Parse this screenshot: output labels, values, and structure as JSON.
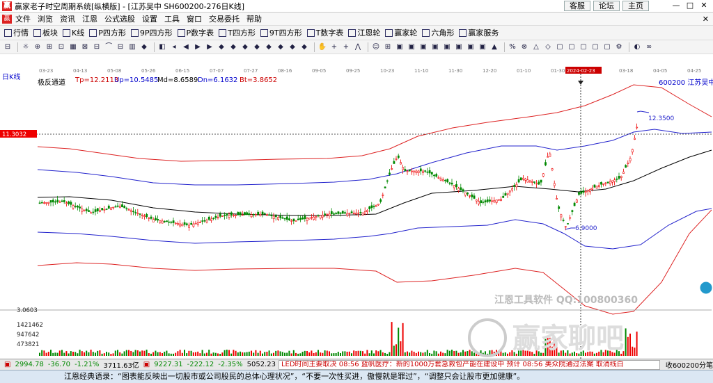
{
  "title": {
    "text": "赢家老子时空周期系统[纵横版] - [江苏吴中  SH600200-276日K线]",
    "links": [
      "客服",
      "论坛",
      "主页"
    ],
    "window_controls": [
      "—",
      "□",
      "✕"
    ]
  },
  "menu": {
    "items": [
      "文件",
      "浏览",
      "资讯",
      "江恩",
      "公式选股",
      "设置",
      "工具",
      "窗口",
      "交易委托",
      "帮助"
    ],
    "close": "✕"
  },
  "toolbar1": {
    "items": [
      {
        "label": "行情",
        "icon": "grid-icon"
      },
      {
        "label": "板块",
        "icon": "blocks-icon"
      },
      {
        "label": "K线",
        "icon": "candle-icon"
      },
      {
        "label": "P四方形",
        "icon": "square-p-icon"
      },
      {
        "label": "9P四方形",
        "icon": "square-9p-icon"
      },
      {
        "label": "P数字表",
        "icon": "table-p-icon"
      },
      {
        "label": "T四方形",
        "icon": "square-t-icon"
      },
      {
        "label": "9T四方形",
        "icon": "square-9t-icon"
      },
      {
        "label": "T数字表",
        "icon": "table-t-icon"
      },
      {
        "label": "江恩轮",
        "icon": "wheel-gann-icon"
      },
      {
        "label": "赢家轮",
        "icon": "wheel-win-icon"
      },
      {
        "label": "六角形",
        "icon": "hexagon-icon"
      },
      {
        "label": "赢家服务",
        "icon": "service-icon"
      }
    ]
  },
  "toolbar2": {
    "glyphs": [
      "⊟",
      "☼",
      "⊕",
      "⊞",
      "⊡",
      "▦",
      "⊠",
      "⊟",
      "⏜",
      "⊟",
      "▥",
      "◆",
      "◧",
      "◂",
      "◀",
      "▶",
      "▶",
      "◆",
      "◆",
      "◆",
      "◆",
      "◆",
      "◆",
      "◆",
      "◆",
      "✋",
      "+",
      "+",
      "⋀",
      "☺",
      "⊞",
      "▣",
      "▣",
      "▣",
      "▣",
      "▣",
      "▣",
      "▣",
      "▣",
      "▲",
      "%",
      "⊗",
      "△",
      "◇",
      "▢",
      "▢",
      "▢",
      "▢",
      "▢",
      "⚙",
      "◐",
      "∞"
    ]
  },
  "chart_panel": {
    "period_label": "日K线",
    "indicator_name": "极反通道",
    "params": [
      {
        "text": "Tp=12.2113",
        "color": "#cc0000"
      },
      {
        "text": "Up=10.5485",
        "color": "#0000cc"
      },
      {
        "text": "Md=8.6589",
        "color": "#000000"
      },
      {
        "text": "Dn=6.1632",
        "color": "#0000cc"
      },
      {
        "text": "Bt=3.8652",
        "color": "#cc0000"
      }
    ],
    "stock_label": "600200 江苏吴中",
    "dates": [
      "03-23",
      "04-13",
      "05-08",
      "05-26",
      "06-15",
      "07-07",
      "07-27",
      "08-16",
      "09-05",
      "09-25",
      "10-23",
      "11-10",
      "11-30",
      "12-20",
      "01-10",
      "01-30",
      "2024-02-23",
      "03-18",
      "04-05",
      "04-25"
    ],
    "cursor_price": "11.3032",
    "high_label": "12.3500",
    "low_label": "6.9000",
    "vol_labels": [
      "3.0603",
      "1421462",
      "947642",
      "473821"
    ],
    "watermark1": "江恩工具软件   QQ:100800360",
    "watermark2": "赢家聊吧"
  },
  "status": {
    "index1": {
      "value": "2994.78",
      "change": "-36.70",
      "pct": "-1.21%",
      "amount": "3711.63亿"
    },
    "index2": {
      "value": "9227.31",
      "change": "-222.12",
      "pct": "-2.35%",
      "amount": "5052.23"
    },
    "ticker": "LED时间主要取决   08:56  蓝帆医疗：新的1000万套急救包产能在建设中 预计   08:56  美众院通过法案 取消线白",
    "right": "收600200分笔"
  },
  "quote": "江恩经典语录：“图表能反映出一切股市或公司股民的总体心理状况”，“不要一次性买进，傲慢就是罪过”，“调整只会让股市更加健康”。"
}
